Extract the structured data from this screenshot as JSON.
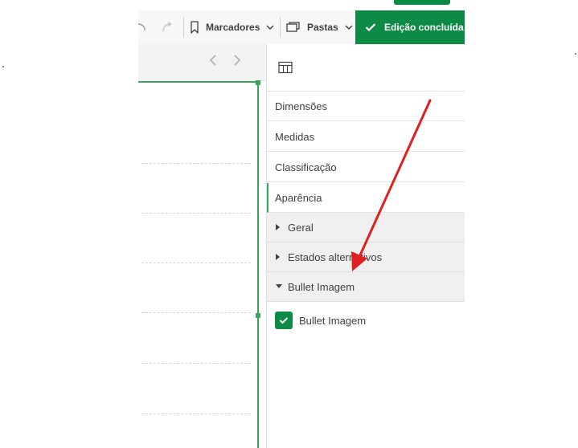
{
  "toolbar": {
    "marcadores_label": "Marcadores",
    "pastas_label": "Pastas",
    "done_label": "Edição concluída"
  },
  "panel": {
    "rows": [
      {
        "label": "Dimensões"
      },
      {
        "label": "Medidas"
      },
      {
        "label": "Classificação"
      },
      {
        "label": "Aparência"
      }
    ],
    "sections": [
      {
        "label": "Geral",
        "expanded": false
      },
      {
        "label": "Estados alternativos",
        "expanded": false
      },
      {
        "label": "Bullet Imagem",
        "expanded": true
      }
    ],
    "checkbox": {
      "label": "Bullet Imagem",
      "checked": true
    }
  },
  "colors": {
    "accent": "#0e8a47",
    "selection": "#3aa55c",
    "annotation_arrow": "#e02020"
  }
}
